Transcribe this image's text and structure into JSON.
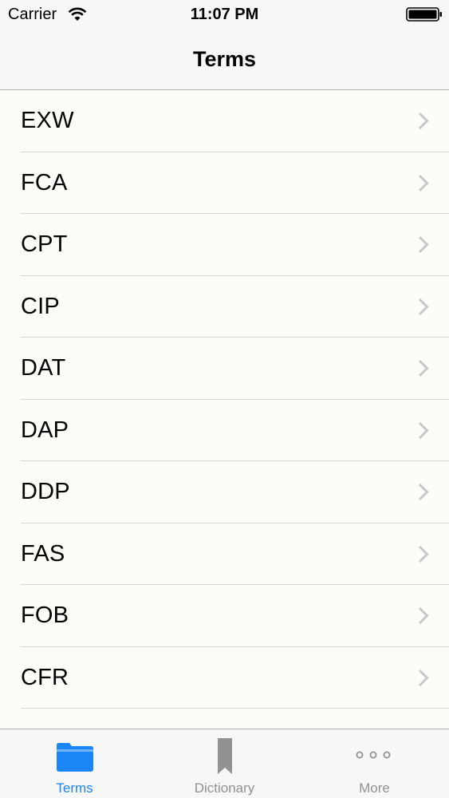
{
  "status_bar": {
    "carrier": "Carrier",
    "time": "11:07 PM",
    "wifi_icon": "wifi-icon",
    "battery_icon": "battery-icon"
  },
  "nav": {
    "title": "Terms"
  },
  "terms": [
    {
      "label": "EXW",
      "icon": "chevron-right-icon"
    },
    {
      "label": "FCA",
      "icon": "chevron-right-icon"
    },
    {
      "label": "CPT",
      "icon": "chevron-right-icon"
    },
    {
      "label": "CIP",
      "icon": "chevron-right-icon"
    },
    {
      "label": "DAT",
      "icon": "chevron-right-icon"
    },
    {
      "label": "DAP",
      "icon": "chevron-right-icon"
    },
    {
      "label": "DDP",
      "icon": "chevron-right-icon"
    },
    {
      "label": "FAS",
      "icon": "chevron-right-icon"
    },
    {
      "label": "FOB",
      "icon": "chevron-right-icon"
    },
    {
      "label": "CFR",
      "icon": "chevron-right-icon"
    }
  ],
  "tabs": [
    {
      "label": "Terms",
      "icon": "folder-icon",
      "selected": true
    },
    {
      "label": "Dictionary",
      "icon": "bookmark-icon",
      "selected": false
    },
    {
      "label": "More",
      "icon": "more-icon",
      "selected": false
    }
  ],
  "colors": {
    "accent": "#1a86f7",
    "inactive": "#929292",
    "chevron": "#c7c7cc",
    "list_background": "#fdfcf8",
    "bar_background": "#f7f7f7"
  }
}
